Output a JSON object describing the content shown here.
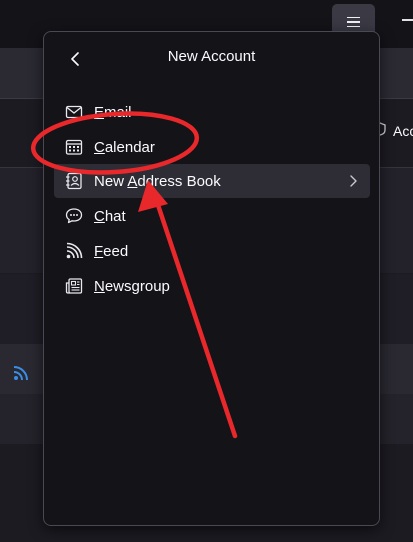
{
  "background": {
    "right_label": "Acc"
  },
  "panel": {
    "title": "New Account",
    "items": [
      {
        "label": "Email",
        "icon": "email-icon",
        "mnemonic_index": 0
      },
      {
        "label": "Calendar",
        "icon": "calendar-icon",
        "mnemonic_index": 0
      },
      {
        "label": "New Address Book",
        "icon": "address-book-icon",
        "mnemonic_index": 4,
        "has_submenu": true
      },
      {
        "label": "Chat",
        "icon": "chat-icon",
        "mnemonic_index": 0
      },
      {
        "label": "Feed",
        "icon": "feed-icon",
        "mnemonic_index": 0
      },
      {
        "label": "Newsgroup",
        "icon": "newsgroup-icon",
        "mnemonic_index": 0
      }
    ]
  },
  "colors": {
    "panel_bg": "#141318",
    "hover_bg": "#2e2d36",
    "annotation_red": "#e8282b",
    "accent_blue": "#3a8ee6"
  }
}
